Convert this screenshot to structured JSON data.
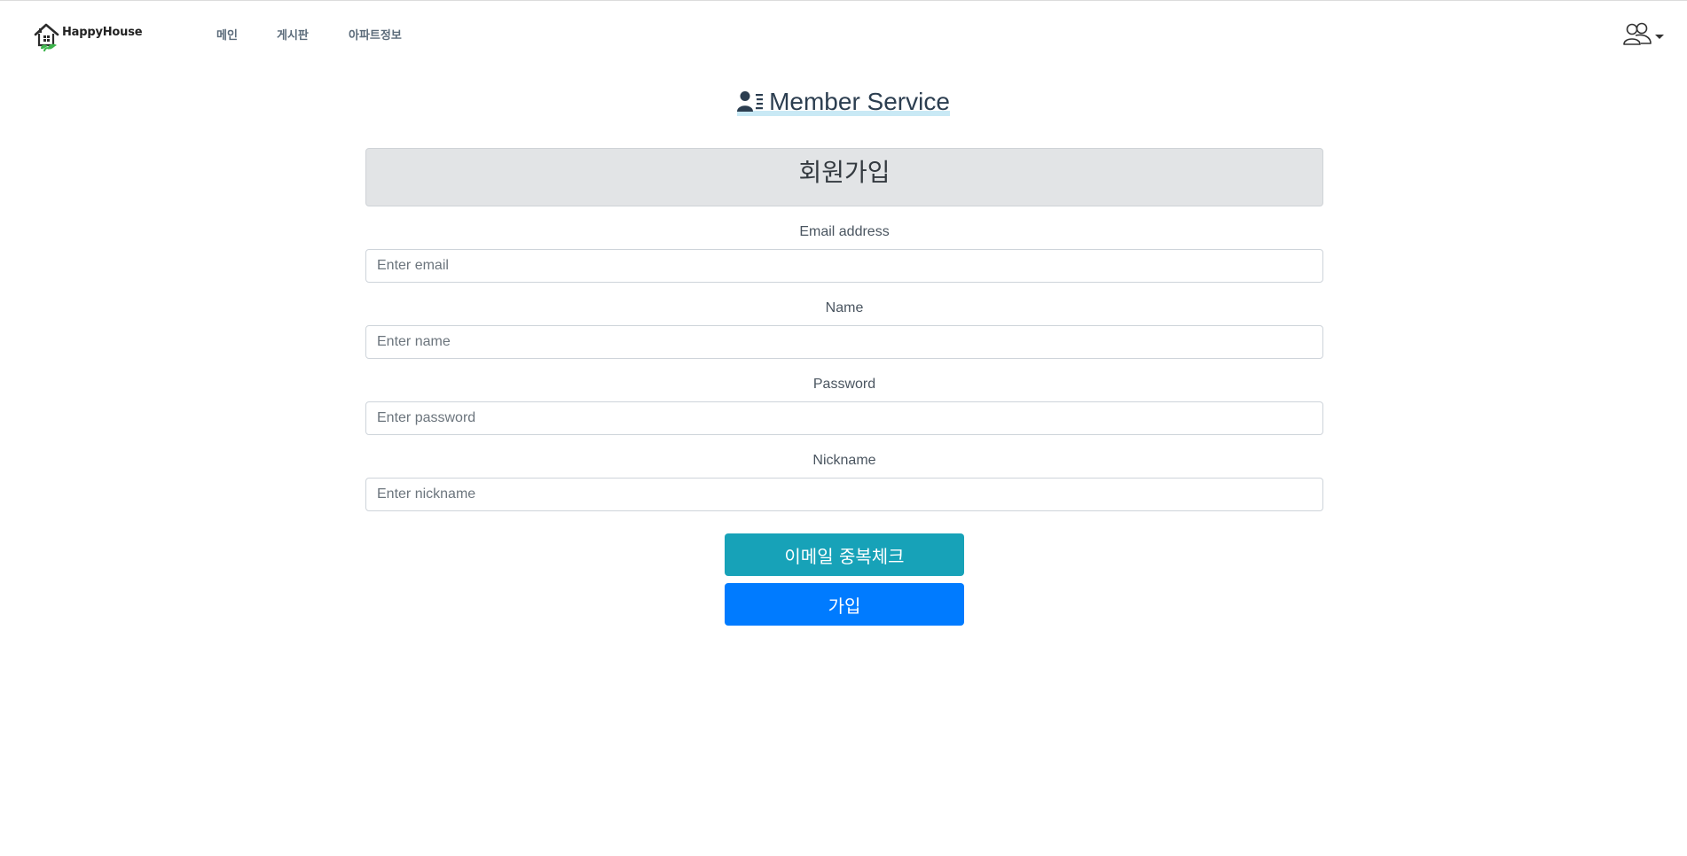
{
  "brand": {
    "name": "HappyHouse"
  },
  "nav": {
    "items": [
      {
        "label": "메인"
      },
      {
        "label": "게시판"
      },
      {
        "label": "아파트정보"
      }
    ]
  },
  "header": {
    "title": "Member Service",
    "icon": "member-service-icon"
  },
  "signup": {
    "heading": "회원가입",
    "fields": [
      {
        "label": "Email address",
        "placeholder": "Enter email",
        "value": ""
      },
      {
        "label": "Name",
        "placeholder": "Enter name",
        "value": ""
      },
      {
        "label": "Password",
        "placeholder": "Enter password",
        "value": ""
      },
      {
        "label": "Nickname",
        "placeholder": "Enter nickname",
        "value": ""
      }
    ],
    "check_email_button": "이메일 중복체크",
    "submit_button": "가입"
  },
  "colors": {
    "accent_info": "#17a2b8",
    "accent_primary": "#007bff",
    "heading_bg": "#e2e4e6",
    "title_underline": "#c9e9f5"
  }
}
